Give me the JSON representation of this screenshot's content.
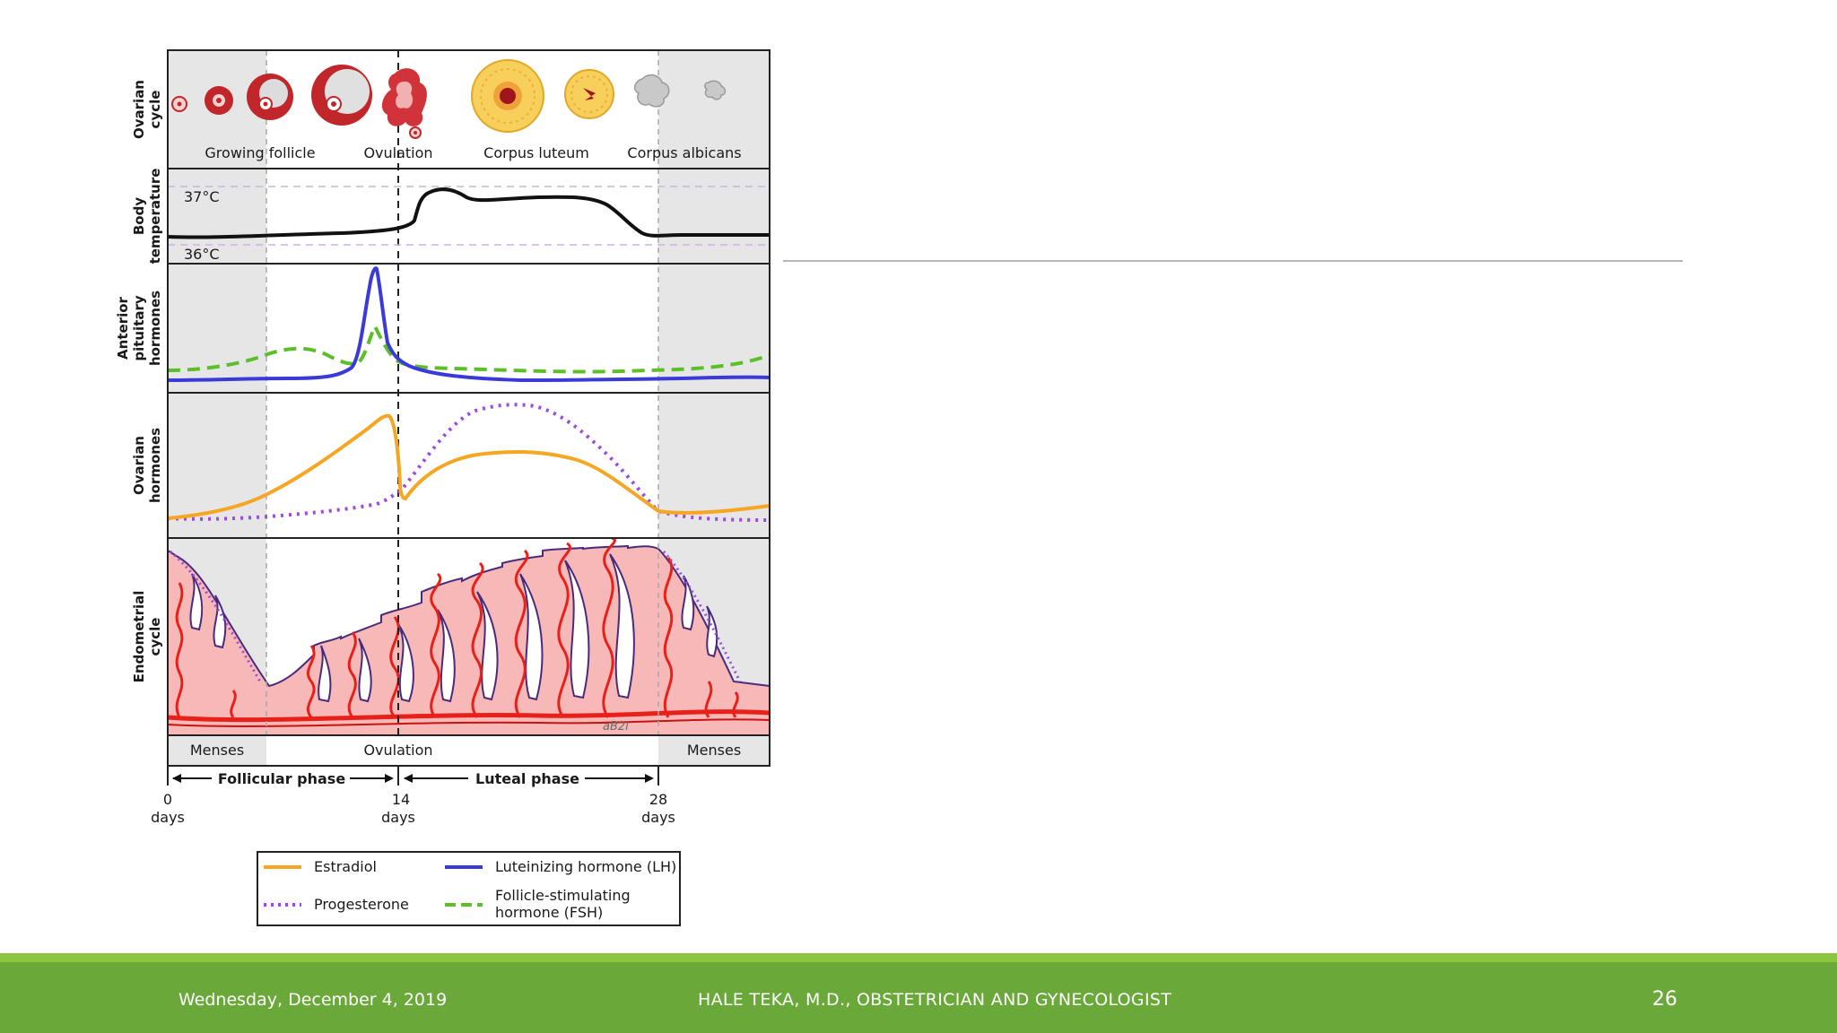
{
  "figure": {
    "row_labels": {
      "ovarian_cycle": [
        "Ovarian",
        "cycle"
      ],
      "body_temperature": [
        "Body",
        "temperature"
      ],
      "anterior_pituitary": [
        "Anterior",
        "pituitary",
        "hormones"
      ],
      "ovarian_hormones": [
        "Ovarian",
        "hormones"
      ],
      "endometrial_cycle": [
        "Endometrial",
        "cycle"
      ]
    },
    "stage_labels": [
      "Growing follicle",
      "Ovulation",
      "Corpus luteum",
      "Corpus albicans"
    ],
    "temperature_marks": {
      "high": "37°C",
      "low": "36°C"
    },
    "bottom_labels": {
      "menses_left": "Menses",
      "ovulation": "Ovulation",
      "menses_right": "Menses"
    },
    "phases": {
      "follicular": "Follicular phase",
      "luteal": "Luteal phase"
    },
    "day_ticks": [
      {
        "value": "0",
        "unit": "days"
      },
      {
        "value": "14",
        "unit": "days"
      },
      {
        "value": "28",
        "unit": "days"
      }
    ],
    "signature": "aB2l",
    "legend": [
      {
        "label": "Estradiol",
        "color": "#f5a623",
        "style": "solid"
      },
      {
        "label": "Luteinizing hormone (LH)",
        "color": "#3a3ad8",
        "style": "solid"
      },
      {
        "label": "Progesterone",
        "color": "#9b4be0",
        "style": "dotted"
      },
      {
        "label_lines": [
          "Follicle-stimulating",
          "hormone (FSH)"
        ],
        "color": "#5cbf2a",
        "style": "dashed"
      }
    ]
  },
  "footer": {
    "date": "Wednesday, December 4, 2019",
    "author": "HALE TEKA, M.D., OBSTETRICIAN AND GYNECOLOGIST",
    "page": "26"
  },
  "colors": {
    "footer_band": "#6aa83a",
    "footer_accent": "#8cc63f",
    "endometrium": "#f7b8b8",
    "vessel": "#e8201a"
  }
}
